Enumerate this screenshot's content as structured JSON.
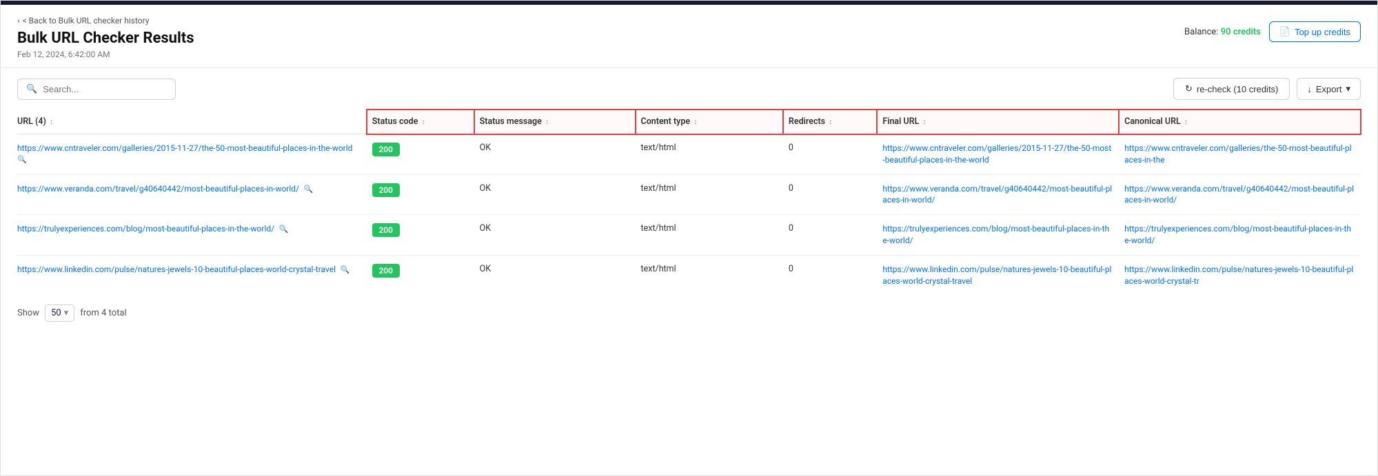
{
  "topBar": {},
  "header": {
    "backLink": "< Back to Bulk URL checker history",
    "title": "Bulk URL Checker Results",
    "subtitle": "Feb 12, 2024, 6:42:00 AM",
    "balance_label": "Balance:",
    "balance_credits": "90 credits",
    "topUpBtn": "Top up credits"
  },
  "toolbar": {
    "search_placeholder": "Search...",
    "recheck_btn": "re-check (10 credits)",
    "export_btn": "Export"
  },
  "table": {
    "columns": [
      {
        "id": "url",
        "label": "URL (4)",
        "sortable": true
      },
      {
        "id": "status_code",
        "label": "Status code",
        "sortable": true
      },
      {
        "id": "status_message",
        "label": "Status message",
        "sortable": true
      },
      {
        "id": "content_type",
        "label": "Content type",
        "sortable": true
      },
      {
        "id": "redirects",
        "label": "Redirects",
        "sortable": true
      },
      {
        "id": "final_url",
        "label": "Final URL",
        "sortable": true
      },
      {
        "id": "canonical_url",
        "label": "Canonical URL",
        "sortable": true
      }
    ],
    "rows": [
      {
        "url": "https://www.cntraveler.com/galleries/2015-11-27/the-50-most-beautiful-places-in-the-world",
        "status_code": "200",
        "status_message": "OK",
        "content_type": "text/html",
        "redirects": "0",
        "final_url": "https://www.cntraveler.com/galleries/2015-11-27/the-50-most-beautiful-places-in-the-world",
        "canonical_url": "https://www.cntraveler.com/galleries/the-50-most-beautiful-places-in-the"
      },
      {
        "url": "https://www.veranda.com/travel/g40640442/most-beautiful-places-in-world/",
        "status_code": "200",
        "status_message": "OK",
        "content_type": "text/html",
        "redirects": "0",
        "final_url": "https://www.veranda.com/travel/g40640442/most-beautiful-places-in-world/",
        "canonical_url": "https://www.veranda.com/travel/g40640442/most-beautiful-places-in-world/"
      },
      {
        "url": "https://trulyexperiences.com/blog/most-beautiful-places-in-the-world/",
        "status_code": "200",
        "status_message": "OK",
        "content_type": "text/html",
        "redirects": "0",
        "final_url": "https://trulyexperiences.com/blog/most-beautiful-places-in-the-world/",
        "canonical_url": "https://trulyexperiences.com/blog/most-beautiful-places-in-the-world/"
      },
      {
        "url": "https://www.linkedin.com/pulse/natures-jewels-10-beautiful-places-world-crystal-travel",
        "status_code": "200",
        "status_message": "OK",
        "content_type": "text/html",
        "redirects": "0",
        "final_url": "https://www.linkedin.com/pulse/natures-jewels-10-beautiful-places-world-crystal-travel",
        "canonical_url": "https://www.linkedin.com/pulse/natures-jewels-10-beautiful-places-world-crystal-tr"
      }
    ]
  },
  "footer": {
    "show_label": "Show",
    "show_value": "50",
    "total_label": "from 4 total"
  },
  "icons": {
    "search": "🔍",
    "refresh": "↺",
    "download": "↓",
    "chevron_down": "▾",
    "back_arrow": "‹",
    "sort": "⇅",
    "magnifier": "🔎"
  },
  "colors": {
    "accent_blue": "#0070f3",
    "green_badge": "#22c55e",
    "highlight_red": "#e53e3e",
    "border": "#e0e0e0",
    "text_dark": "#111",
    "text_mid": "#333",
    "text_light": "#777"
  }
}
